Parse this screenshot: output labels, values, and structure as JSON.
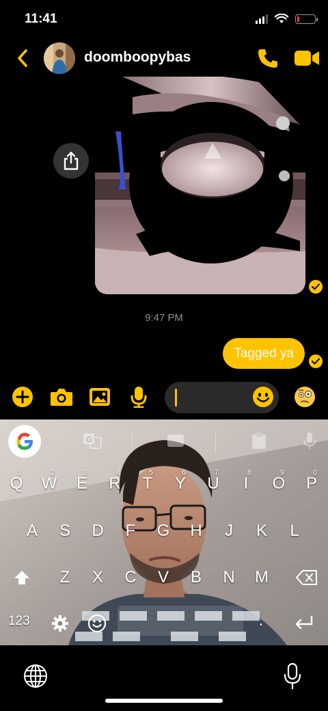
{
  "status_bar": {
    "time": "11:41",
    "battery_level": 0.12,
    "battery_color": "#ff3b30"
  },
  "header": {
    "contact_name": "doomboopybas",
    "back_icon": "chevron-left-icon",
    "call_icon": "phone-icon",
    "video_icon": "video-camera-icon",
    "accent_color": "#ffc300"
  },
  "messages": {
    "image_attachment": "3d-render-image",
    "share_icon": "share-icon",
    "timestamp": "9:47 PM",
    "outgoing_text": "Tagged ya",
    "read_receipt_icon": "check-circle-icon"
  },
  "composer": {
    "plus_icon": "plus-icon",
    "camera_icon": "camera-icon",
    "gallery_icon": "image-icon",
    "mic_icon": "microphone-icon",
    "input_value": "",
    "emoji_icon": "smiley-icon",
    "sticker_icon": "thinking-face-icon"
  },
  "keyboard": {
    "toolbar": [
      "google-icon",
      "translate-icon",
      "gif-icon",
      "clipboard-icon",
      "microphone-icon"
    ],
    "row1": [
      {
        "key": "Q",
        "hint": "1"
      },
      {
        "key": "W",
        "hint": "2"
      },
      {
        "key": "E",
        "hint": "3"
      },
      {
        "key": "R",
        "hint": "4"
      },
      {
        "key": "T",
        "hint": "5"
      },
      {
        "key": "Y",
        "hint": "6"
      },
      {
        "key": "U",
        "hint": "7"
      },
      {
        "key": "I",
        "hint": "8"
      },
      {
        "key": "O",
        "hint": "9"
      },
      {
        "key": "P",
        "hint": "0"
      }
    ],
    "row2": [
      "A",
      "S",
      "D",
      "F",
      "G",
      "H",
      "J",
      "K",
      "L"
    ],
    "row3": [
      "Z",
      "X",
      "C",
      "V",
      "B",
      "N",
      "M"
    ],
    "numbers_key": "123",
    "period_key": "."
  },
  "bottom_bar": {
    "globe_icon": "globe-icon",
    "dictation_icon": "microphone-icon"
  }
}
